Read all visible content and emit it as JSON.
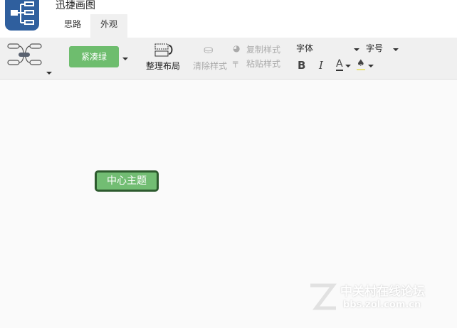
{
  "app": {
    "title": "迅捷画图"
  },
  "tabs": [
    {
      "label": "思路"
    },
    {
      "label": "外观"
    }
  ],
  "toolbar": {
    "theme": "紧凑绿",
    "arrange": "整理布局",
    "clear_style": "清除样式",
    "copy_style": "复制样式",
    "paste_style": "粘贴样式",
    "font": "字体",
    "font_size": "字号",
    "bold": "B",
    "italic": "I",
    "font_color": "A"
  },
  "canvas": {
    "central_topic": "中心主题"
  },
  "watermark": {
    "line1": "中关村在线论坛",
    "line2": "bbs.zol.com.cn"
  }
}
